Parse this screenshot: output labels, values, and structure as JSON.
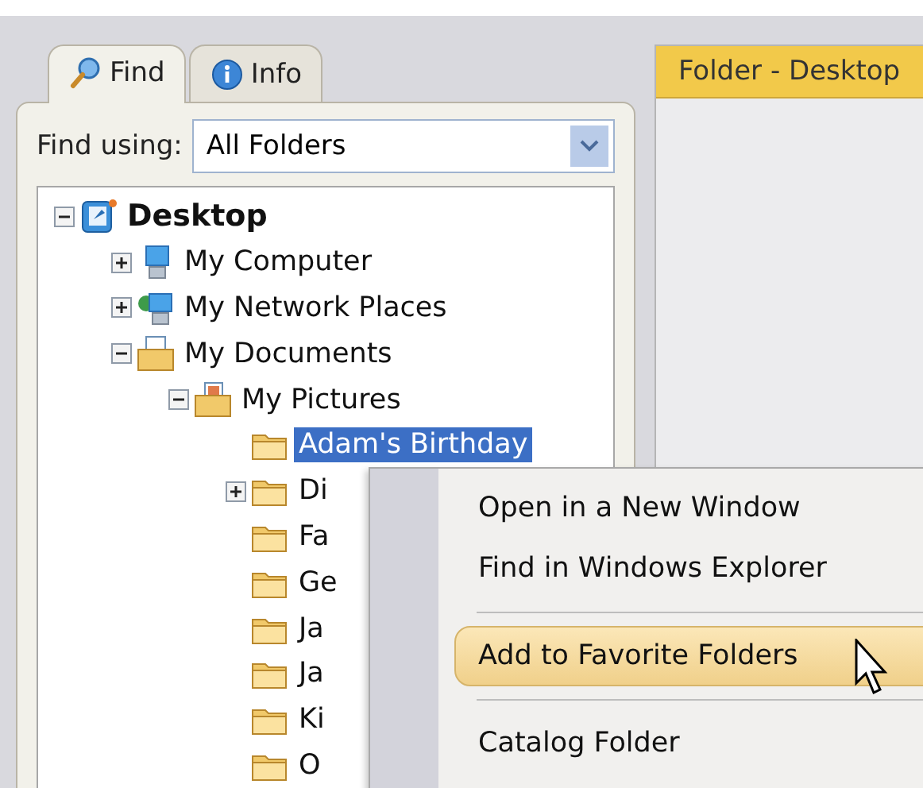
{
  "tabs": [
    {
      "label": "Find",
      "kind": "find",
      "selected": true
    },
    {
      "label": "Info",
      "kind": "info",
      "selected": false
    }
  ],
  "find_using": {
    "label": "Find using:",
    "value": "All Folders"
  },
  "tree": [
    {
      "label": "Desktop",
      "kind": "desktop",
      "expanded": true,
      "selected": false,
      "children": [
        {
          "label": "My Computer",
          "kind": "computer",
          "expanded": false,
          "selected": false
        },
        {
          "label": "My Network Places",
          "kind": "network",
          "expanded": false,
          "selected": false
        },
        {
          "label": "My Documents",
          "kind": "documents",
          "expanded": true,
          "selected": false,
          "children": [
            {
              "label": "My Pictures",
              "kind": "pictures",
              "expanded": true,
              "selected": false,
              "children": [
                {
                  "label": "Adam's Birthday",
                  "kind": "folder",
                  "selected": true
                },
                {
                  "label": "Di",
                  "kind": "folder",
                  "expanded": false,
                  "selected": false
                },
                {
                  "label": "Fa",
                  "kind": "folder",
                  "selected": false
                },
                {
                  "label": "Ge",
                  "kind": "folder",
                  "selected": false
                },
                {
                  "label": "Ja",
                  "kind": "folder",
                  "selected": false
                },
                {
                  "label": "Ja",
                  "kind": "folder",
                  "selected": false
                },
                {
                  "label": "Ki",
                  "kind": "folder",
                  "selected": false
                },
                {
                  "label": "O",
                  "kind": "folder",
                  "selected": false
                }
              ]
            }
          ]
        }
      ]
    }
  ],
  "folder_panel": {
    "title": "Folder - Desktop"
  },
  "context_menu": [
    {
      "kind": "item",
      "label": "Open in a New Window",
      "selected": false
    },
    {
      "kind": "item",
      "label": "Find in Windows Explorer",
      "selected": false
    },
    {
      "kind": "separator"
    },
    {
      "kind": "item",
      "label": "Add to Favorite Folders",
      "selected": true
    },
    {
      "kind": "separator"
    },
    {
      "kind": "item",
      "label": "Catalog Folder",
      "selected": false
    }
  ]
}
